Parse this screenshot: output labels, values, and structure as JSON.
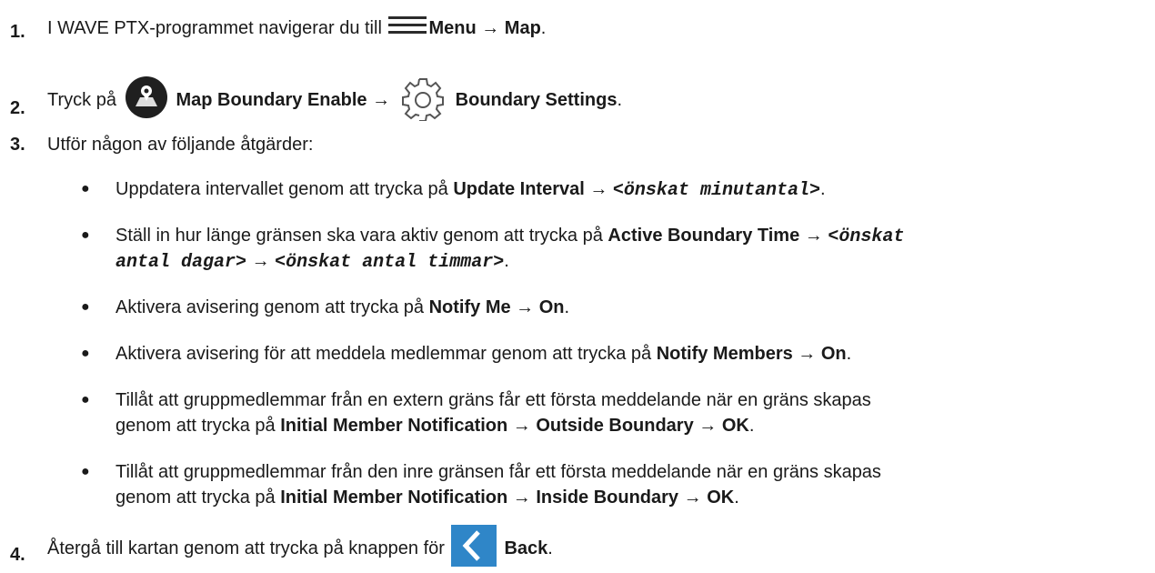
{
  "steps": [
    {
      "number": "1.",
      "pre": "I WAVE PTX-programmet navigerar du till ",
      "menu": "Menu",
      "arrow": " → ",
      "map": "Map",
      "end": "."
    },
    {
      "number": "2.",
      "pre": "Tryck på ",
      "enable": "Map Boundary Enable",
      "arrow": " → ",
      "settings": "Boundary Settings",
      "end": "."
    },
    {
      "number": "3.",
      "text": "Utför någon av följande åtgärder:"
    },
    {
      "number": "4.",
      "pre": "Återgå till kartan genom att trycka på knappen för ",
      "back": "Back",
      "end": "."
    }
  ],
  "bullets": [
    {
      "pre": "Uppdatera intervallet genom att trycka på ",
      "b1": "Update Interval",
      "arrow": " → ",
      "m1": "<önskat minutantal>",
      "end": "."
    },
    {
      "pre": "Ställ in hur länge gränsen ska vara aktiv genom att trycka på ",
      "b1": "Active Boundary Time",
      "arrow": " → ",
      "m1a": "<önskat",
      "m1b": "antal dagar>",
      "arrow2": " → ",
      "m2": "<önskat antal timmar>",
      "end": "."
    },
    {
      "pre": "Aktivera avisering genom att trycka på ",
      "b1": "Notify Me",
      "arrow": " → ",
      "b2": "On",
      "end": "."
    },
    {
      "pre": "Aktivera avisering för att meddela medlemmar genom att trycka på ",
      "b1": "Notify Members",
      "arrow": " → ",
      "b2": "On",
      "end": "."
    },
    {
      "line1": "Tillåt att gruppmedlemmar från en extern gräns får ett första meddelande när en gräns skapas",
      "pre2": "genom att trycka på ",
      "b1": "Initial Member Notification",
      "arrow": " → ",
      "b2": "Outside Boundary",
      "arrow2": " → ",
      "b3": "OK",
      "end": "."
    },
    {
      "line1": "Tillåt att gruppmedlemmar från den inre gränsen får ett första meddelande när en gräns skapas",
      "pre2": "genom att trycka på ",
      "b1": "Initial Member Notification",
      "arrow": " → ",
      "b2": "Inside Boundary",
      "arrow2": " → ",
      "b3": "OK",
      "end": "."
    }
  ],
  "icons": {
    "menu": "hamburger-menu-icon",
    "mapEnable": "map-boundary-enable-icon",
    "settings": "gear-icon",
    "back": "back-chevron-icon"
  },
  "colors": {
    "text": "#1a1a1a",
    "backButton": "#2f86c8",
    "mapIcon": "#1f1f1f"
  }
}
